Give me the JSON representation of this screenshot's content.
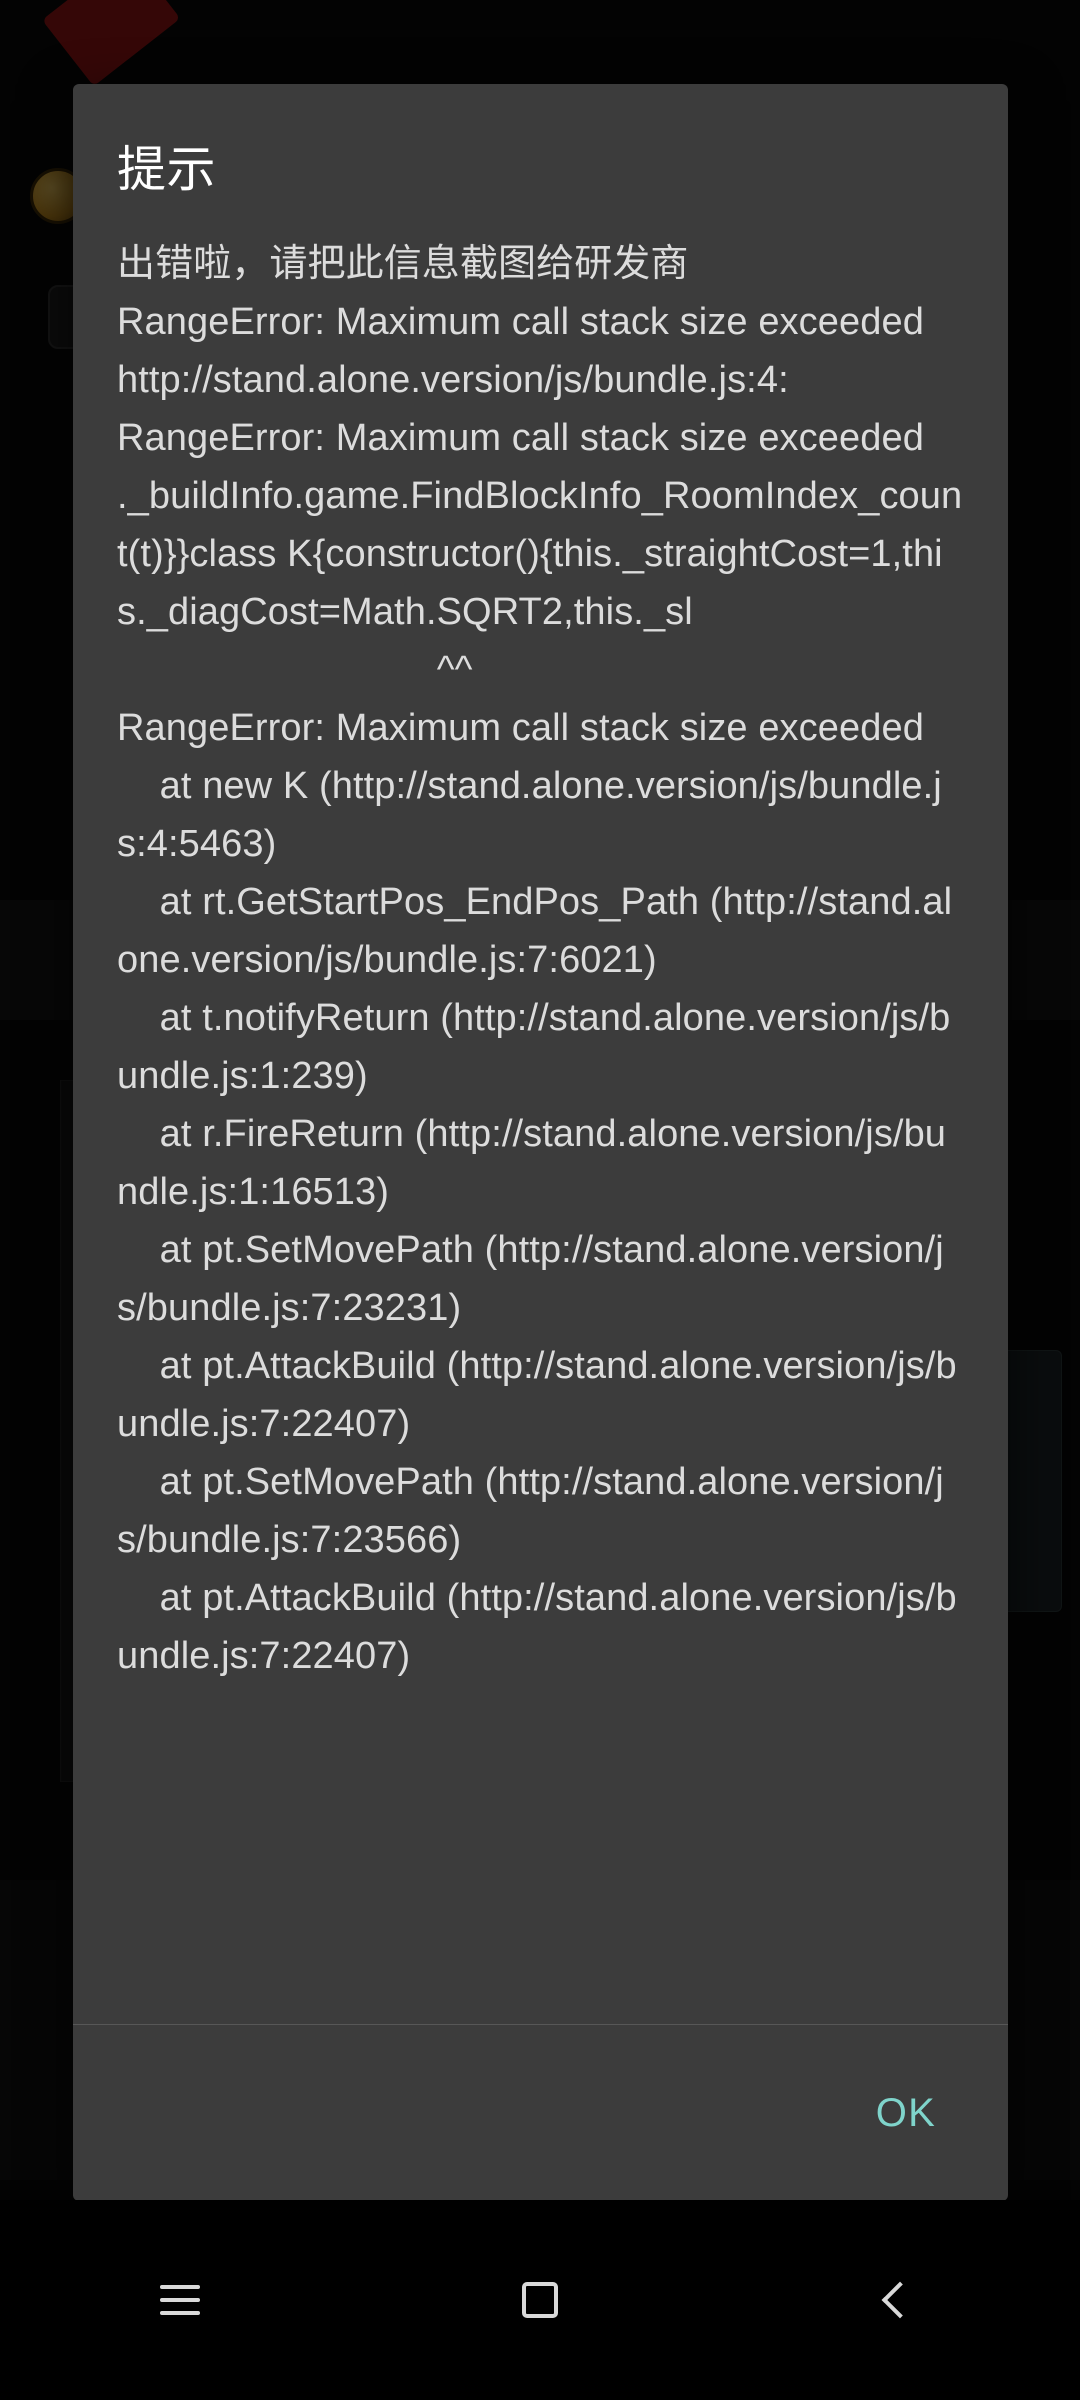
{
  "dialog": {
    "title": "提示",
    "message": "出错啦，请把此信息截图给研发商\nRangeError: Maximum call stack size exceeded\nhttp://stand.alone.version/js/bundle.js:4:\nRangeError: Maximum call stack size exceeded\n._buildInfo.game.FindBlockInfo_RoomIndex_count(t)}}class K{constructor(){this._straightCost=1,this._diagCost=Math.SQRT2,this._sl\n                              ^^\nRangeError: Maximum call stack size exceeded\n    at new K (http://stand.alone.version/js/bundle.js:4:5463)\n    at rt.GetStartPos_EndPos_Path (http://stand.alone.version/js/bundle.js:7:6021)\n    at t.notifyReturn (http://stand.alone.version/js/bundle.js:1:239)\n    at r.FireReturn (http://stand.alone.version/js/bundle.js:1:16513)\n    at pt.SetMovePath (http://stand.alone.version/js/bundle.js:7:23231)\n    at pt.AttackBuild (http://stand.alone.version/js/bundle.js:7:22407)\n    at pt.SetMovePath (http://stand.alone.version/js/bundle.js:7:23566)\n    at pt.AttackBuild (http://stand.alone.version/js/bundle.js:7:22407)",
    "ok_label": "OK"
  },
  "navbar": {
    "recents_label": "recents-icon",
    "home_label": "home-icon",
    "back_label": "back-icon"
  },
  "colors": {
    "dialog_surface": "#3c3c3c",
    "title_text": "#ffffff",
    "body_text": "#dcdcdc",
    "accent": "#7fd4cb",
    "divider": "#575757",
    "scrim": "#000000"
  }
}
